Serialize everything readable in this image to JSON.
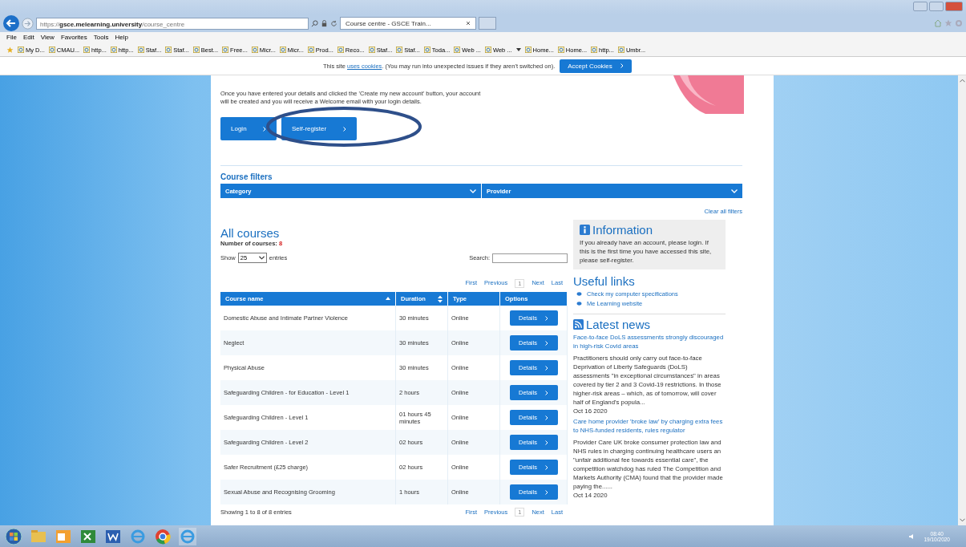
{
  "browser": {
    "address": {
      "scheme": "https://",
      "host": "gsce.melearning.university",
      "path": "/course_centre"
    },
    "tab": {
      "title": "Course centre - GSCE Train...",
      "selected": true
    },
    "menu": [
      "File",
      "Edit",
      "View",
      "Favorites",
      "Tools",
      "Help"
    ],
    "favorites": [
      {
        "label": "My D...",
        "dropdown": false
      },
      {
        "label": "CMAU...",
        "dropdown": false
      },
      {
        "label": "http...",
        "dropdown": false
      },
      {
        "label": "http...",
        "dropdown": false
      },
      {
        "label": "Staf...",
        "dropdown": false
      },
      {
        "label": "Staf...",
        "dropdown": false
      },
      {
        "label": "Best...",
        "dropdown": false
      },
      {
        "label": "Free...",
        "dropdown": false
      },
      {
        "label": "Micr...",
        "dropdown": false
      },
      {
        "label": "Micr...",
        "dropdown": false
      },
      {
        "label": "Prod...",
        "dropdown": false
      },
      {
        "label": "Reco...",
        "dropdown": false
      },
      {
        "label": "Staf...",
        "dropdown": false
      },
      {
        "label": "Staf...",
        "dropdown": false
      },
      {
        "label": "Toda...",
        "dropdown": false
      },
      {
        "label": "Web ...",
        "dropdown": false
      },
      {
        "label": "Web ...",
        "dropdown": true
      },
      {
        "label": "Home...",
        "dropdown": false
      },
      {
        "label": "Home...",
        "dropdown": false
      },
      {
        "label": "http...",
        "dropdown": false
      },
      {
        "label": "Umbr...",
        "dropdown": false
      }
    ]
  },
  "cookie_bar": {
    "before": "This site",
    "link": "uses cookies",
    "after": ". (You may run into unexpected issues if they aren't switched on).",
    "button": "Accept Cookies"
  },
  "intro": "Once you have entered your details and clicked the 'Create my new account' button, your account will be created and you will receive a Welcome email with your login details.",
  "auth_buttons": [
    "Login",
    "Self-register"
  ],
  "filters": {
    "title": "Course filters",
    "dropdowns": [
      "Category",
      "Provider"
    ],
    "clear": "Clear all filters"
  },
  "courses": {
    "title": "All courses",
    "count_label": "Number of courses:",
    "count": "8",
    "show_label": "Show",
    "show_value": "25",
    "entries_label": "entries",
    "search_label": "Search:",
    "pager": [
      "First",
      "Previous",
      "1",
      "Next",
      "Last"
    ],
    "columns": [
      {
        "label": "Course name",
        "sortable": true,
        "sorted": true
      },
      {
        "label": "Duration",
        "sortable": true,
        "sorted": false
      },
      {
        "label": "Type",
        "sortable": false,
        "sorted": false
      },
      {
        "label": "Options",
        "sortable": false,
        "sorted": false
      }
    ],
    "rows": [
      {
        "name": "Domestic Abuse and Intimate Partner Violence",
        "duration": "30 minutes",
        "type": "Online",
        "action": "Details"
      },
      {
        "name": "Neglect",
        "duration": "30 minutes",
        "type": "Online",
        "action": "Details"
      },
      {
        "name": "Physical Abuse",
        "duration": "30 minutes",
        "type": "Online",
        "action": "Details"
      },
      {
        "name": "Safeguarding Children - for Education - Level 1",
        "duration": "2 hours",
        "type": "Online",
        "action": "Details"
      },
      {
        "name": "Safeguarding Children - Level 1",
        "duration": "01 hours 45 minutes",
        "type": "Online",
        "action": "Details"
      },
      {
        "name": "Safeguarding Children - Level 2",
        "duration": "02 hours",
        "type": "Online",
        "action": "Details"
      },
      {
        "name": "Safer Recruitment (£25 charge)",
        "duration": "02 hours",
        "type": "Online",
        "action": "Details"
      },
      {
        "name": "Sexual Abuse and Recognising Grooming",
        "duration": "1 hours",
        "type": "Online",
        "action": "Details"
      }
    ],
    "footer": "Showing 1 to 8 of 8 entries",
    "footer_pager": [
      "First",
      "Previous",
      "1",
      "Next",
      "Last"
    ]
  },
  "information": {
    "title": "Information",
    "text": "If you already have an account, please login. If this is the first time you have accessed this site, please self-register."
  },
  "useful_links": {
    "title": "Useful links",
    "links": [
      "Check my computer specifications",
      "Me Learning website"
    ]
  },
  "latest_news": {
    "title": "Latest news",
    "items": [
      {
        "headline": "Face-to-face DoLS assessments strongly discouraged in high-risk Covid areas",
        "summary": "Practitioners should only carry out face-to-face Deprivation of Liberty Safeguards (DoLS) assessments \"in exceptional circumstances\" in areas covered by tier 2 and 3 Covid-19 restrictions. In those higher-risk areas – which, as of tomorrow, will cover half of England's popula...",
        "date": "Oct 16 2020"
      },
      {
        "headline": "Care home provider 'broke law' by charging extra fees to NHS-funded residents, rules regulator",
        "summary": "Provider Care UK broke consumer protection law and NHS rules in charging continuing healthcare users an \"unfair additional fee towards essential care\", the competition watchdog has ruled The Competition and Markets Authority (CMA) found that the provider made paying the......",
        "date": "Oct 14 2020"
      }
    ]
  },
  "taskbar": {
    "time": "08:40",
    "date": "19/10/2020"
  }
}
